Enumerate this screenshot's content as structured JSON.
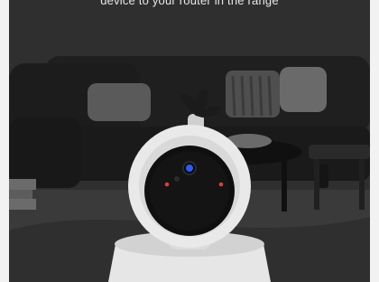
{
  "caption": {
    "text": "device to your router in the range"
  },
  "icons": {
    "sofa": "sofa-illustration",
    "camera": "security-camera-illustration"
  },
  "colors": {
    "background": "#2f2f2f",
    "sofa": "#1f1f1f",
    "camera_shell": "#e9e9e9",
    "lens": "#0f0f0f",
    "led_blue": "#2a5cff",
    "led_red": "#e23b3b"
  }
}
